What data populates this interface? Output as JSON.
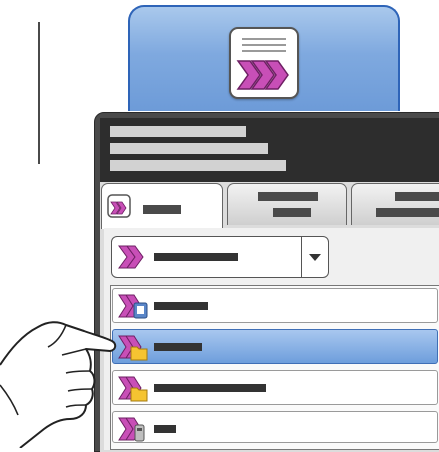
{
  "colors": {
    "accent_blue": "#7fa9df",
    "selection_blue": "#6e9edc",
    "magenta_icon": "#c84fb7",
    "panel_dark": "#2d2d2d",
    "placeholder_bar": "#333333"
  },
  "icons": {
    "app_tile": "scan-document-icon",
    "tab_active": "scan-icon",
    "dropdown": "scan-arrows-icon",
    "rows": [
      "scan-to-usb-icon",
      "scan-to-folder-icon",
      "scan-to-folder-icon",
      "scan-to-mailbox-icon"
    ]
  },
  "screen": {
    "selected_row_index": 1,
    "list_row_count": 4
  }
}
